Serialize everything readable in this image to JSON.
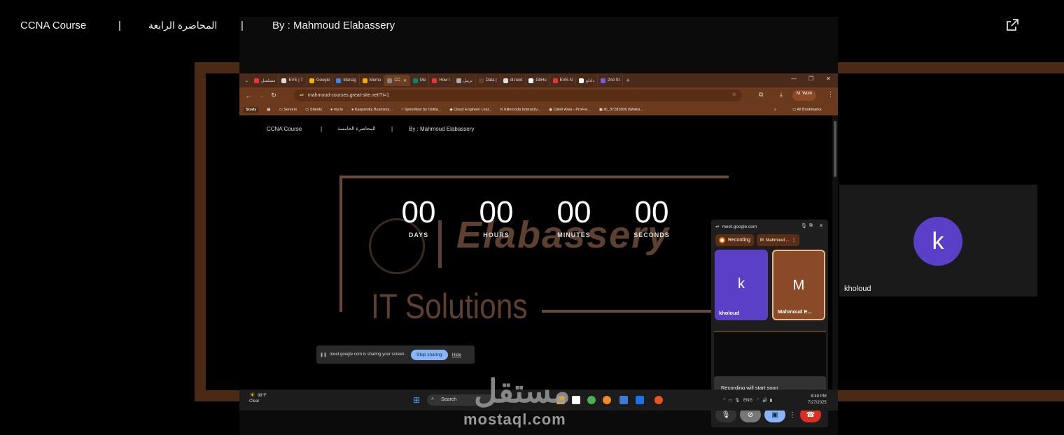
{
  "header": {
    "course": "CCNA Course",
    "sep1": "|",
    "lecture": "المحاضرة الرابعة",
    "sep2": "|",
    "by": "By : Mahmoud Elabassery",
    "open_icon": "open-in-new-icon"
  },
  "browser": {
    "tabs": [
      "مسلسل",
      "EVE | T",
      "Google",
      "Manag",
      "Memo",
      "CC",
      "Me",
      "How t",
      "ترتيل",
      "Data |",
      "dl.next",
      "GitHu",
      "EVE-N",
      "دادلو",
      "2nd St"
    ],
    "url": "mahmoud-courses.great-site.net/?i=1",
    "profile_label": "Work",
    "profile_initial": "M",
    "bookmarks": [
      "Study",
      "Servers",
      "Sheets",
      "my.te",
      "Kaspersky Business...",
      "Speedtest by Ookla...",
      "Cloud Engineer Lear...",
      "Killercoda Interactiv...",
      "Client Area - ProFre...",
      "ifc_37281606 (Websi...",
      "All Bookmarks"
    ]
  },
  "page": {
    "course": "CCNA Course",
    "sep1": "|",
    "lecture": "المحاضرة الخامسة",
    "sep2": "|",
    "by": "By : Mahmoud Elabassery",
    "logo_text": "Elabassery",
    "logo_sub": "IT Solutions",
    "countdown": [
      {
        "value": "00",
        "label": "DAYS"
      },
      {
        "value": "00",
        "label": "HOURS"
      },
      {
        "value": "00",
        "label": "MINUTES"
      },
      {
        "value": "00",
        "label": "SECONDS"
      }
    ]
  },
  "share_bar": {
    "text": "meet.google.com is sharing your screen.",
    "stop": "Stop sharing",
    "hide": "Hide"
  },
  "meet": {
    "domain": "meet.google.com",
    "recording": "Recording",
    "presenter": "Mahmoud ...",
    "presenter_initial": "M",
    "tiles": [
      {
        "initial": "k",
        "name": "kholoud",
        "color": "#5b3fc7"
      },
      {
        "initial": "M",
        "name": "Mahmoud E...",
        "color": "#8a4a28"
      }
    ],
    "recording_soon": "Recording will start soon"
  },
  "taskbar": {
    "temp": "98°F",
    "weather": "Clear",
    "search": "Search",
    "lang": "ENG",
    "time": "8:48 PM",
    "date": "7/27/2025"
  },
  "watermark": {
    "latin": "mostaql.com",
    "arabic": "مستقل"
  },
  "participant": {
    "initial": "k",
    "name": "kholoud",
    "avatar_color": "#5b3fc7"
  }
}
